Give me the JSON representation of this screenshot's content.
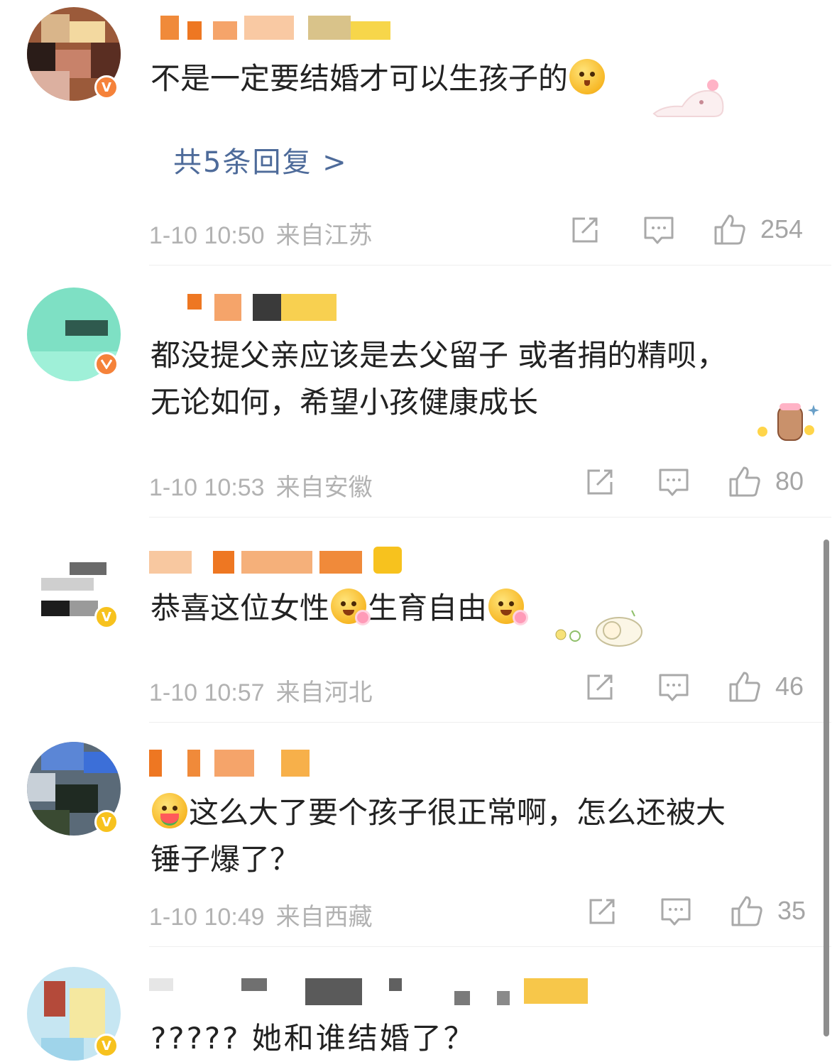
{
  "comments": [
    {
      "text": "不是一定要结婚才可以生孩子的",
      "replies_label": "共5条回复 >",
      "time": "1-10 10:50",
      "location": "来自江苏",
      "likes": "254",
      "badge": "V",
      "badge_color": "#f5823a"
    },
    {
      "text_line1": "都没提父亲应该是去父留子  或者捐的精呗，",
      "text_line2": "无论如何，希望小孩健康成长",
      "time": "1-10 10:53",
      "location": "来自安徽",
      "likes": "80",
      "badge": "",
      "badge_color": "#f5823a"
    },
    {
      "text_a": "恭喜这位女性",
      "text_b": "生育自由",
      "time": "1-10 10:57",
      "location": "来自河北",
      "likes": "46",
      "badge": "V",
      "badge_color": "#f7c21e"
    },
    {
      "text_line1": "这么大了要个孩子很正常啊，怎么还被大",
      "text_line2": "锤子爆了？",
      "time": "1-10 10:49",
      "location": "来自西藏",
      "likes": "35",
      "badge": "V",
      "badge_color": "#f7c21e"
    },
    {
      "text": "?????  她和谁结婚了？",
      "badge": "V",
      "badge_color": "#f7c21e"
    }
  ],
  "icons": {
    "share": "share-icon",
    "comment": "comment-icon",
    "like": "thumbs-up-icon"
  }
}
